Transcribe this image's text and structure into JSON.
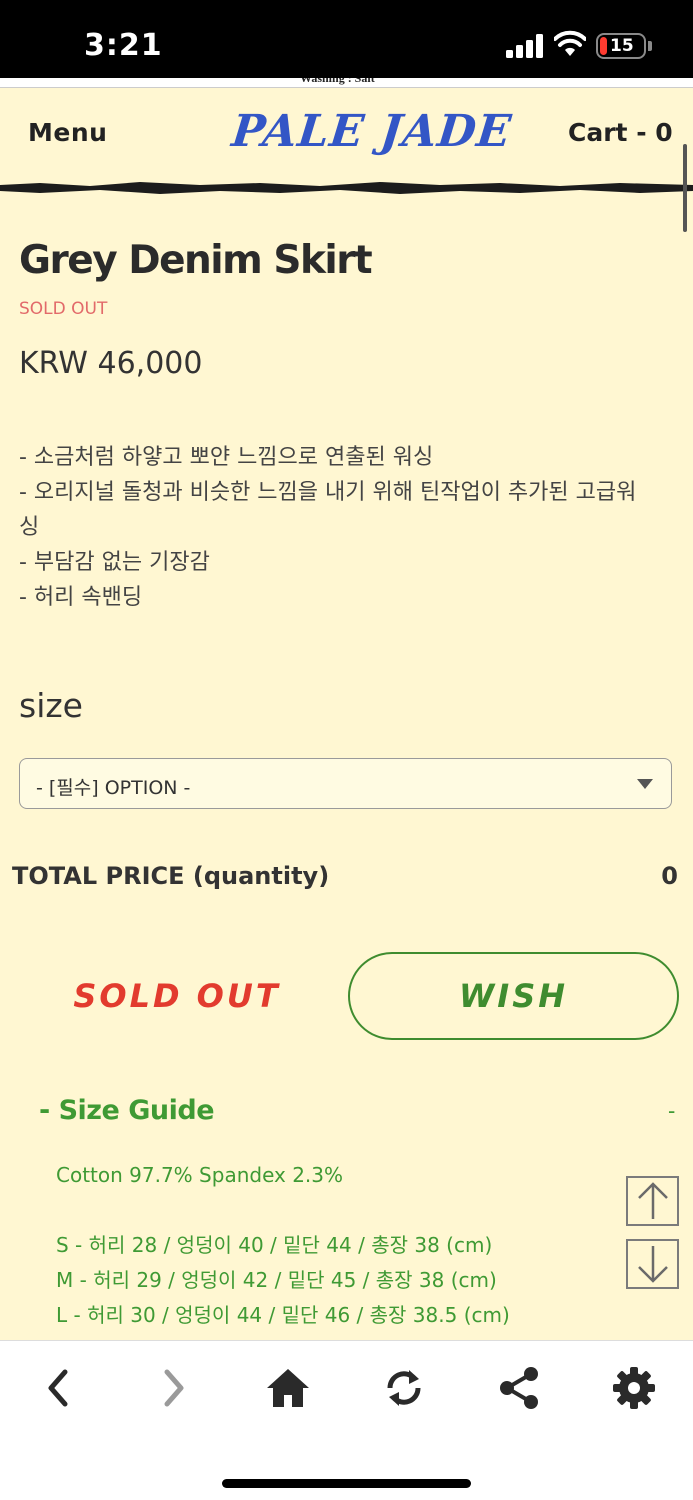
{
  "status_bar": {
    "time": "3:21",
    "battery": "15"
  },
  "top_strip_text": "Washing : Salt",
  "header": {
    "menu": "Menu",
    "logo": "PALE JADE",
    "cart": "Cart - 0"
  },
  "product": {
    "title": "Grey Denim Skirt",
    "status": "SOLD OUT",
    "price": "KRW 46,000",
    "description": [
      "- 소금처럼 하얗고 뽀얀 느낌으로 연출된 워싱",
      "- 오리지널 돌청과 비슷한 느낌을 내기 위해 틴작업이 추가된 고급워",
      "싱",
      "- 부담감 없는 기장감",
      "- 허리 속밴딩"
    ]
  },
  "option": {
    "label": "size",
    "selected": "- [필수] OPTION -"
  },
  "total": {
    "label": "TOTAL PRICE (quantity)",
    "value": "0"
  },
  "buttons": {
    "sold_out": "SOLD OUT",
    "wish": "WISH"
  },
  "size_guide": {
    "title": "- Size Guide",
    "toggle": "-",
    "material": "Cotton 97.7% Spandex 2.3%",
    "rows": [
      "S - 허리 28 / 엉덩이 40 / 밑단 44 / 총장 38 (cm)",
      "M - 허리 29 / 엉덩이 42 / 밑단 45 / 총장 38 (cm)",
      "L - 허리 30 / 엉덩이 44 / 밑단 46 / 총장 38.5 (cm)"
    ]
  },
  "colors": {
    "background": "#fff7d2",
    "logo": "#3356c6",
    "green": "#3f8c2f",
    "red": "#e23b2e"
  },
  "toolbar_icons": [
    "back-icon",
    "forward-icon",
    "home-icon",
    "reload-icon",
    "share-icon",
    "settings-icon"
  ]
}
